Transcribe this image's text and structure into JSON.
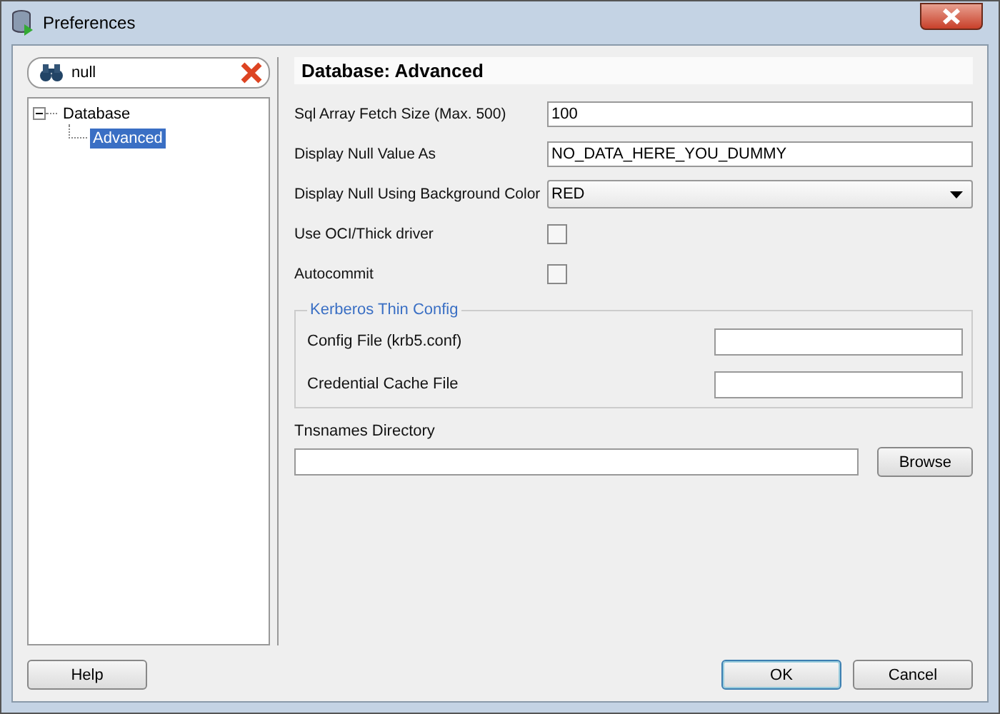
{
  "window": {
    "title": "Preferences"
  },
  "search": {
    "value": "null"
  },
  "tree": [
    {
      "label": "Database",
      "expanded": true,
      "selected": false,
      "children": [
        {
          "label": "Advanced",
          "selected": true
        }
      ]
    }
  ],
  "panel": {
    "title": "Database: Advanced",
    "settings": [
      {
        "kind": "text",
        "label": "Sql Array Fetch Size (Max. 500)",
        "value": "100"
      },
      {
        "kind": "text",
        "label": "Display Null Value As",
        "value": "NO_DATA_HERE_YOU_DUMMY"
      },
      {
        "kind": "dropdown",
        "label": "Display Null Using Background Color",
        "value": "RED"
      },
      {
        "kind": "checkbox",
        "label": "Use OCI/Thick driver",
        "checked": false
      },
      {
        "kind": "checkbox",
        "label": "Autocommit",
        "checked": false
      }
    ],
    "kerberos": {
      "title": "Kerberos Thin Config",
      "fields": [
        {
          "label": "Config File (krb5.conf)"
        },
        {
          "label": "Credential Cache File"
        }
      ]
    },
    "tnsnames": {
      "label": "Tnsnames Directory",
      "button": "Browse"
    }
  },
  "buttons": [
    {
      "kind": "help",
      "label": "Help"
    },
    {
      "kind": "default",
      "label": "OK"
    },
    {
      "kind": "normal",
      "label": "Cancel"
    }
  ]
}
